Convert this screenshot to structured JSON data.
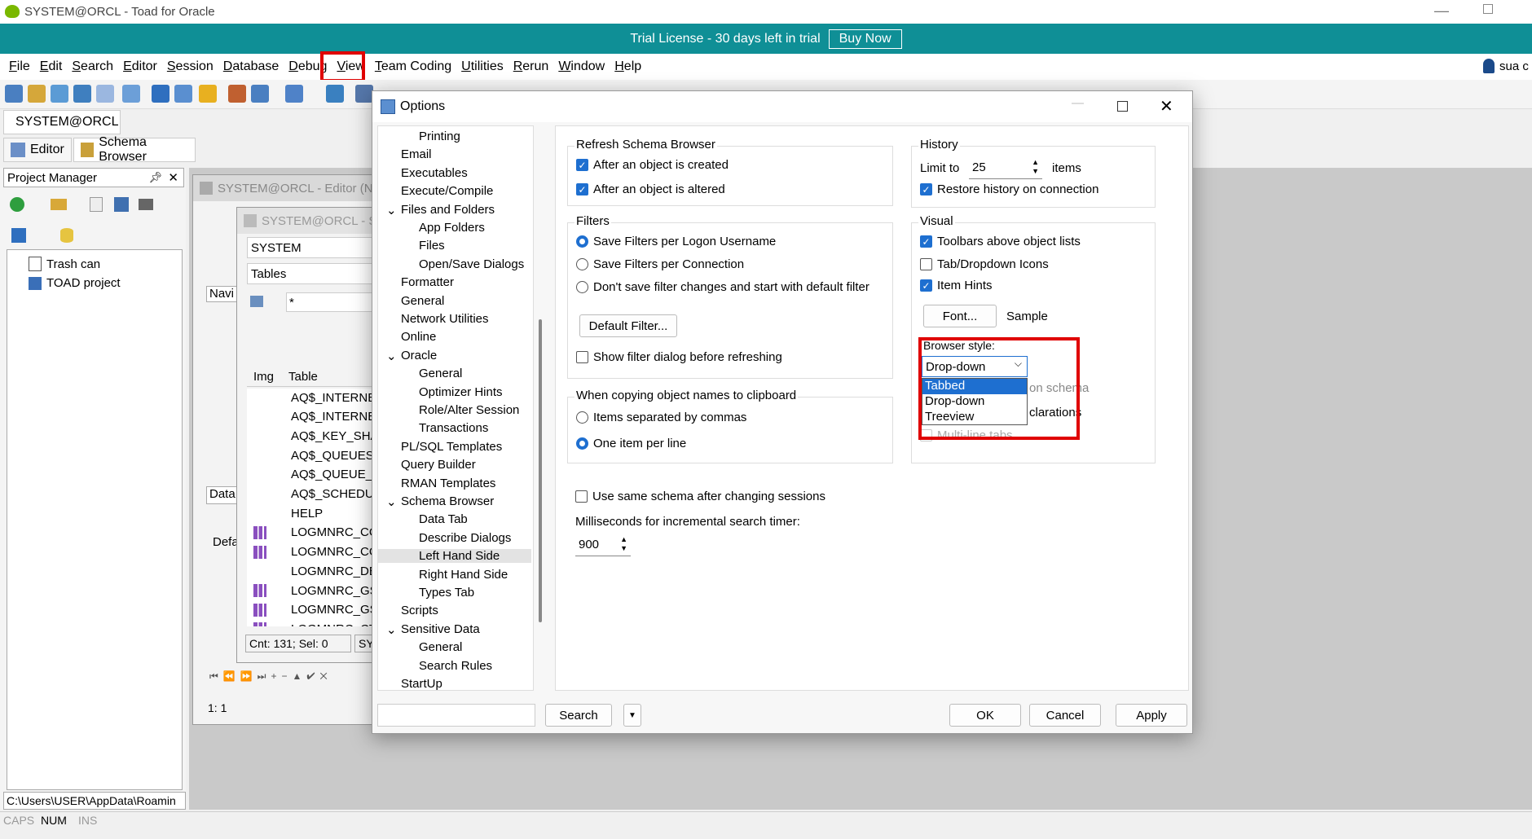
{
  "window": {
    "title": "SYSTEM@ORCL - Toad for Oracle",
    "user": "sua c"
  },
  "trial": {
    "text": "Trial License - 30 days left in trial",
    "buy": "Buy Now"
  },
  "menu": [
    "File",
    "Edit",
    "Search",
    "Editor",
    "Session",
    "Database",
    "Debug",
    "View",
    "Team Coding",
    "Utilities",
    "Rerun",
    "Window",
    "Help"
  ],
  "connection_tab": "SYSTEM@ORCL",
  "tabs": {
    "editor": "Editor",
    "schema_browser": "Schema Browser"
  },
  "project_manager": {
    "title": "Project Manager",
    "items": [
      "Trash can",
      "TOAD project"
    ],
    "path": "C:\\Users\\USER\\AppData\\Roamin"
  },
  "editor_window": {
    "title": "SYSTEM@ORCL - Editor (N",
    "navi": "Navi",
    "data": "Data",
    "defa": "Defa",
    "pos": "1:  1"
  },
  "schema_window": {
    "title": "SYSTEM@ORCL - S",
    "schema": "SYSTEM",
    "object_type": "Tables",
    "filter": "*",
    "cols": {
      "img": "Img",
      "table": "Table"
    },
    "rows": [
      "AQ$_INTERNET",
      "AQ$_INTERNET",
      "AQ$_KEY_SHAF",
      "AQ$_QUEUES",
      "AQ$_QUEUE_TA",
      "AQ$_SCHEDUL",
      "HELP",
      "LOGMNRC_CO",
      "LOGMNRC_CO",
      "LOGMNRC_DB",
      "LOGMNRC_GSI",
      "LOGMNRC_GSI",
      "LOGMNRC_CTI"
    ],
    "count": "Cnt: 131; Sel: 0",
    "sys": "SYS"
  },
  "status": {
    "caps": "CAPS",
    "num": "NUM",
    "ins": "INS"
  },
  "dialog": {
    "title": "Options",
    "tree": [
      {
        "label": "Printing",
        "level": 1
      },
      {
        "label": "Email",
        "level": 0
      },
      {
        "label": "Executables",
        "level": 0
      },
      {
        "label": "Execute/Compile",
        "level": 0
      },
      {
        "label": "Files and Folders",
        "level": 0,
        "expand": "v"
      },
      {
        "label": "App Folders",
        "level": 1
      },
      {
        "label": "Files",
        "level": 1
      },
      {
        "label": "Open/Save Dialogs",
        "level": 1
      },
      {
        "label": "Formatter",
        "level": 0
      },
      {
        "label": "General",
        "level": 0
      },
      {
        "label": "Network Utilities",
        "level": 0
      },
      {
        "label": "Online",
        "level": 0
      },
      {
        "label": "Oracle",
        "level": 0,
        "expand": "v"
      },
      {
        "label": "General",
        "level": 1
      },
      {
        "label": "Optimizer Hints",
        "level": 1
      },
      {
        "label": "Role/Alter Session",
        "level": 1
      },
      {
        "label": "Transactions",
        "level": 1
      },
      {
        "label": "PL/SQL Templates",
        "level": 0
      },
      {
        "label": "Query Builder",
        "level": 0
      },
      {
        "label": "RMAN Templates",
        "level": 0
      },
      {
        "label": "Schema Browser",
        "level": 0,
        "expand": "v"
      },
      {
        "label": "Data Tab",
        "level": 1
      },
      {
        "label": "Describe Dialogs",
        "level": 1
      },
      {
        "label": "Left Hand Side",
        "level": 1,
        "selected": true
      },
      {
        "label": "Right Hand Side",
        "level": 1
      },
      {
        "label": "Types Tab",
        "level": 1
      },
      {
        "label": "Scripts",
        "level": 0
      },
      {
        "label": "Sensitive Data",
        "level": 0,
        "expand": "v"
      },
      {
        "label": "General",
        "level": 1
      },
      {
        "label": "Search Rules",
        "level": 1
      },
      {
        "label": "StartUp",
        "level": 0
      }
    ],
    "refresh": {
      "title": "Refresh Schema Browser",
      "created": "After an object is created",
      "altered": "After an object is altered"
    },
    "filters": {
      "title": "Filters",
      "opt1": "Save Filters per Logon Username",
      "opt2": "Save Filters per Connection",
      "opt3": "Don't save filter changes and start with default filter",
      "default_btn": "Default Filter...",
      "show_dialog": "Show filter dialog before refreshing"
    },
    "clipboard": {
      "title": "When copying object names to clipboard",
      "opt1": "Items separated by commas",
      "opt2": "One item per line"
    },
    "same_schema": "Use same schema after changing sessions",
    "ms_label": "Milliseconds for incremental search timer:",
    "ms_value": "900",
    "history": {
      "title": "History",
      "limit_label": "Limit to",
      "limit_value": "25",
      "items": "items",
      "restore": "Restore history on connection"
    },
    "visual": {
      "title": "Visual",
      "toolbars": "Toolbars above object lists",
      "tab_icons": "Tab/Dropdown Icons",
      "item_hints": "Item Hints",
      "font_btn": "Font...",
      "sample": "Sample",
      "browser_style_label": "Browser style:",
      "browser_style_value": "Drop-down",
      "options": [
        "Tabbed",
        "Drop-down",
        "Treeview"
      ],
      "hidden1": "on schema",
      "hidden2": "clarations",
      "multiline": "Multi-line tabs"
    },
    "search_btn": "Search",
    "ok": "OK",
    "cancel": "Cancel",
    "apply": "Apply"
  }
}
